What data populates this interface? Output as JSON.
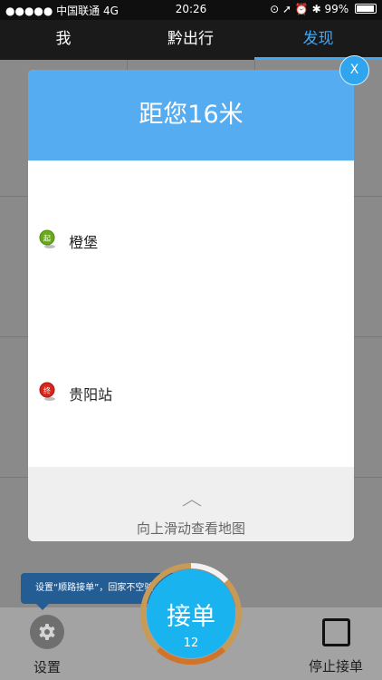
{
  "status_bar": {
    "carrier": "●●●●● 中国联通  4G",
    "time": "20:26",
    "right": "⊙ ➚ ⏰ ✱ 99%"
  },
  "nav": {
    "tabs": [
      {
        "label": "我"
      },
      {
        "label": "黔出行"
      },
      {
        "label": "发现",
        "active": true
      }
    ],
    "active_color": "#3fa9f5"
  },
  "modal": {
    "distance_title": "距您16米",
    "close_label": "X",
    "start": {
      "badge": "起",
      "name": "橙堡",
      "pin_color": "#6aa91e"
    },
    "end": {
      "badge": "终",
      "name": "贵阳站",
      "pin_color": "#d9261c"
    },
    "swipe_hint": "向上滑动查看地图",
    "header_color": "#56acf0"
  },
  "tooltip": {
    "text": "设置“顺路接单”，回家不空驶"
  },
  "bottom_bar": {
    "settings_label": "设置",
    "accept_label": "接单",
    "accept_count": "12",
    "stop_label": "停止接单"
  }
}
